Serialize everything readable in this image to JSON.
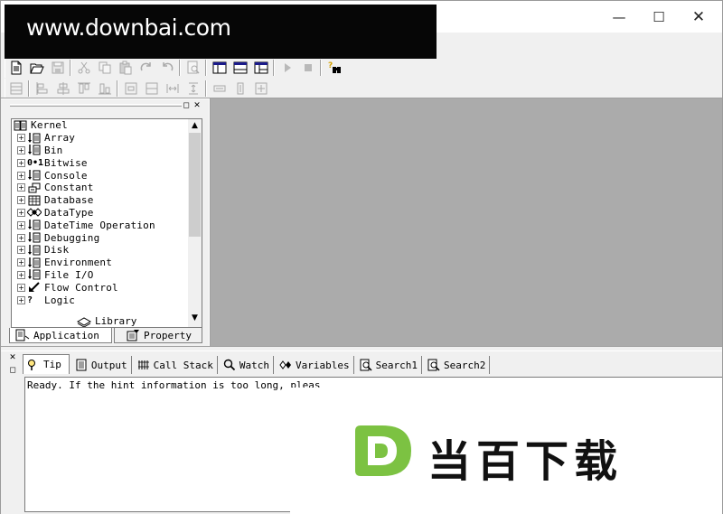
{
  "watermark": {
    "top_text": "www.downbai.com",
    "bottom_text": "当百下载",
    "logo_letter": "D"
  },
  "window_controls": {
    "minimize": "—",
    "maximize": "☐",
    "close": "✕"
  },
  "left_panel": {
    "tree": {
      "root": "Kernel",
      "items": [
        {
          "label": "Array",
          "icon": "doc-arrow-icon"
        },
        {
          "label": "Bin",
          "icon": "doc-arrow-icon"
        },
        {
          "label": "Bitwise",
          "icon": "binary-icon",
          "icon_text": "0•1"
        },
        {
          "label": "Console",
          "icon": "doc-arrow-icon"
        },
        {
          "label": "Constant",
          "icon": "constant-icon"
        },
        {
          "label": "Database",
          "icon": "database-grid-icon"
        },
        {
          "label": "DataType",
          "icon": "diamonds-icon"
        },
        {
          "label": "DateTime Operation",
          "icon": "doc-arrow-icon"
        },
        {
          "label": "Debugging",
          "icon": "doc-arrow-icon"
        },
        {
          "label": "Disk",
          "icon": "doc-arrow-icon"
        },
        {
          "label": "Environment",
          "icon": "doc-arrow-icon"
        },
        {
          "label": "File I/O",
          "icon": "doc-arrow-icon"
        },
        {
          "label": "Flow Control",
          "icon": "flow-arrow-icon"
        },
        {
          "label": "Logic",
          "icon": "question-icon",
          "icon_text": "?"
        }
      ]
    },
    "library_caption": "Library",
    "tabs": {
      "application": "Application",
      "property": "Property"
    }
  },
  "bottom_panel": {
    "tabs": [
      {
        "id": "tip",
        "label": "Tip",
        "icon": "tip-icon"
      },
      {
        "id": "output",
        "label": "Output",
        "icon": "output-icon"
      },
      {
        "id": "callstack",
        "label": "Call Stack",
        "icon": "call-stack-icon"
      },
      {
        "id": "watch",
        "label": "Watch",
        "icon": "watch-magnifier-icon"
      },
      {
        "id": "variables",
        "label": "Variables",
        "icon": "variables-icon"
      },
      {
        "id": "search1",
        "label": "Search1",
        "icon": "search-icon"
      },
      {
        "id": "search2",
        "label": "Search2",
        "icon": "search-icon"
      }
    ],
    "output_text": "Ready. If the hint information is too long, pleas"
  }
}
